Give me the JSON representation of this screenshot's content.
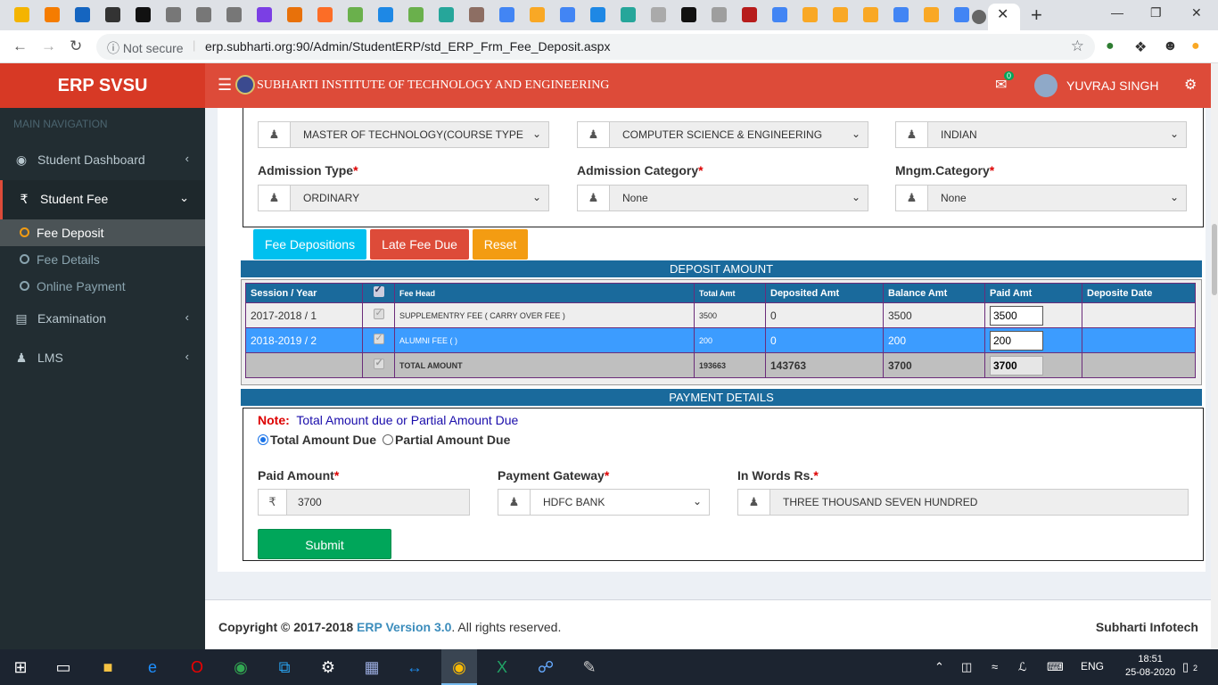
{
  "browser": {
    "security_label": "Not secure",
    "url": "erp.subharti.org:90/Admin/StudentERP/std_ERP_Frm_Fee_Deposit.aspx",
    "tab_close": "✕",
    "new_tab": "+"
  },
  "app": {
    "brand": "ERP SVSU",
    "institute": "SUBHARTI INSTITUTE OF TECHNOLOGY AND ENGINEERING",
    "mail_badge": "0",
    "user_name": "YUVRAJ SINGH",
    "accent_color": "#dd4b39"
  },
  "sidebar": {
    "header": "MAIN NAVIGATION",
    "items": [
      {
        "label": "Student Dashboard",
        "icon": "dashboard-icon"
      },
      {
        "label": "Student Fee",
        "icon": "rupee-icon"
      },
      {
        "label": "Examination",
        "icon": "book-icon"
      },
      {
        "label": "LMS",
        "icon": "user-icon"
      }
    ],
    "sub_items": [
      {
        "label": "Fee Deposit"
      },
      {
        "label": "Fee Details"
      },
      {
        "label": "Online Payment"
      }
    ]
  },
  "form": {
    "course": "MASTER OF TECHNOLOGY(COURSE TYPE",
    "specialization": "COMPUTER SCIENCE & ENGINEERING",
    "student_type": "INDIAN",
    "admission_type_label": "Admission Type",
    "admission_type": "ORDINARY",
    "admission_category_label": "Admission Category",
    "admission_category": "None",
    "mngm_category_label": "Mngm.Category",
    "mngm_category": "None",
    "required_mark": "*"
  },
  "buttons": {
    "fee_depositions": "Fee Depositions",
    "late_fee_due": "Late Fee Due",
    "reset": "Reset",
    "submit": "Submit"
  },
  "deposit": {
    "title": "DEPOSIT AMOUNT",
    "headers": [
      "Session / Year",
      "",
      "Fee Head",
      "Total Amt",
      "Deposited Amt",
      "Balance Amt",
      "Paid Amt",
      "Deposite Date"
    ],
    "rows": [
      {
        "session": "2017-2018 / 1",
        "fee_head": "SUPPLEMENTRY FEE ( CARRY OVER FEE )",
        "total": "3500",
        "deposited": "0",
        "balance": "3500",
        "paid": "3500",
        "date": ""
      },
      {
        "session": "2018-2019 / 2",
        "fee_head": "ALUMNI FEE ( )",
        "total": "200",
        "deposited": "0",
        "balance": "200",
        "paid": "200",
        "date": ""
      }
    ],
    "total_row": {
      "label": "TOTAL AMOUNT",
      "total": "193663",
      "deposited": "143763",
      "balance": "3700",
      "paid": "3700"
    }
  },
  "payment": {
    "title": "PAYMENT DETAILS",
    "note_label": "Note:",
    "note_text": "Total Amount due or Partial Amount Due",
    "radio_total": "Total Amount Due",
    "radio_partial": "Partial Amount Due",
    "paid_amount_label": "Paid Amount",
    "paid_amount": "3700",
    "gateway_label": "Payment Gateway",
    "gateway": "HDFC BANK",
    "words_label": "In Words Rs.",
    "words": "THREE THOUSAND SEVEN HUNDRED"
  },
  "footer": {
    "copyright": "Copyright © 2017-2018",
    "version": "ERP Version 3.0",
    "rights": ". All rights reserved.",
    "company": "Subharti Infotech"
  },
  "taskbar": {
    "lang": "ENG",
    "time": "18:51",
    "date": "25-08-2020",
    "notifications": "2"
  }
}
